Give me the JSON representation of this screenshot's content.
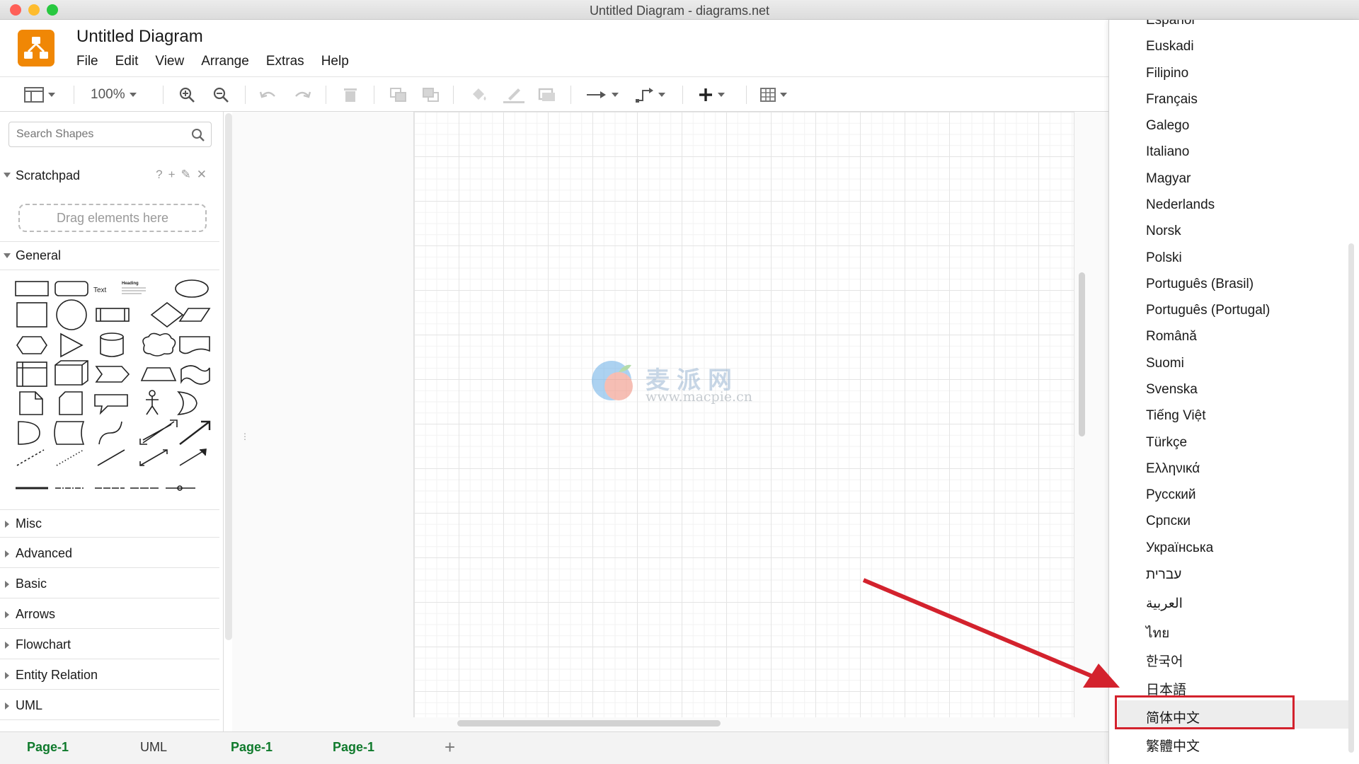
{
  "window": {
    "title": "Untitled Diagram - diagrams.net",
    "lights": [
      "#ff5f57",
      "#febc2e",
      "#28c840"
    ]
  },
  "header": {
    "doc_title": "Untitled Diagram",
    "menus": [
      "File",
      "Edit",
      "View",
      "Arrange",
      "Extras",
      "Help"
    ]
  },
  "toolbar": {
    "zoom": "100%",
    "items": [
      "format-panel-icon",
      "zoom-in-icon",
      "zoom-out-icon",
      "undo-icon",
      "redo-icon",
      "delete-icon",
      "to-front-icon",
      "to-back-icon",
      "fill-color-icon",
      "line-color-icon",
      "shadow-icon",
      "connection-icon",
      "waypoints-icon",
      "insert-icon",
      "table-icon"
    ]
  },
  "sidebar": {
    "search_placeholder": "Search Shapes",
    "scratchpad": {
      "label": "Scratchpad",
      "tools": [
        "?",
        "+",
        "✎",
        "✕"
      ],
      "drop_hint": "Drag elements here"
    },
    "general_label": "General",
    "shape_text": "Text",
    "shape_heading": "Heading",
    "collapsed_sections": [
      "Misc",
      "Advanced",
      "Basic",
      "Arrows",
      "Flowchart",
      "Entity Relation",
      "UML"
    ]
  },
  "tabs": {
    "items": [
      "Page-1",
      "UML",
      "Page-1",
      "Page-1"
    ],
    "add_label": "+"
  },
  "watermark": {
    "brand": "麦派网",
    "url": "www.macpie.cn"
  },
  "language_menu": {
    "items": [
      "Español",
      "Euskadi",
      "Filipino",
      "Français",
      "Galego",
      "Italiano",
      "Magyar",
      "Nederlands",
      "Norsk",
      "Polski",
      "Português (Brasil)",
      "Português (Portugal)",
      "Română",
      "Suomi",
      "Svenska",
      "Tiếng Việt",
      "Türkçe",
      "Ελληνικά",
      "Русский",
      "Српски",
      "Українська",
      "עברית",
      "العربية",
      "ไทย",
      "한국어",
      "日本語",
      "简体中文",
      "繁體中文"
    ],
    "selected": "简体中文"
  },
  "colors": {
    "accent_orange": "#f08705",
    "tab_green": "#0f7a2c",
    "highlight_red": "#d3222d"
  }
}
